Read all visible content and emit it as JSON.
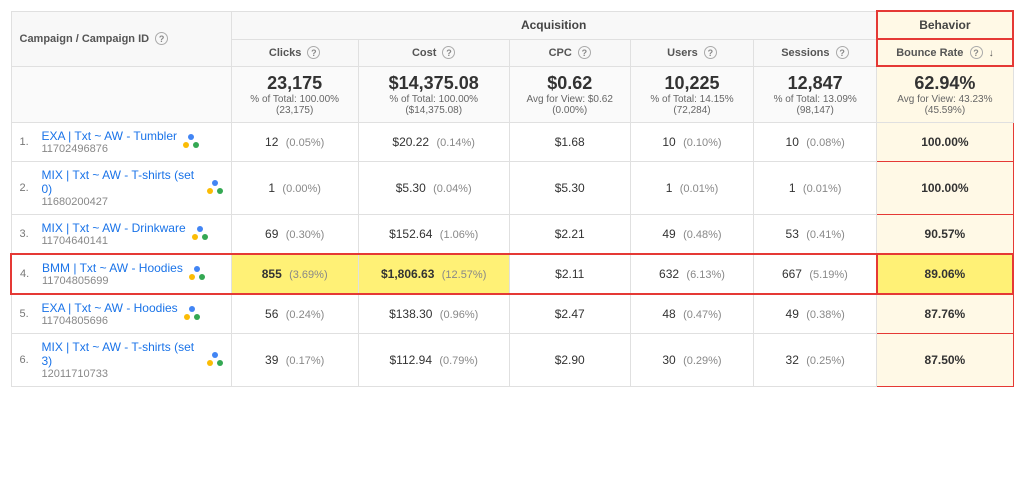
{
  "table": {
    "sections": {
      "acquisition_label": "Acquisition",
      "behavior_label": "Behavior"
    },
    "headers": {
      "campaign": "Campaign / Campaign ID",
      "clicks": "Clicks",
      "cost": "Cost",
      "cpc": "CPC",
      "users": "Users",
      "sessions": "Sessions",
      "bounce_rate": "Bounce Rate"
    },
    "totals": {
      "clicks_main": "23,175",
      "clicks_sub": "% of Total: 100.00% (23,175)",
      "cost_main": "$14,375.08",
      "cost_sub": "% of Total: 100.00% ($14,375.08)",
      "cpc_main": "$0.62",
      "cpc_sub": "Avg for View: $0.62 (0.00%)",
      "users_main": "10,225",
      "users_sub": "% of Total: 14.15% (72,284)",
      "sessions_main": "12,847",
      "sessions_sub": "% of Total: 13.09% (98,147)",
      "bounce_main": "62.94%",
      "bounce_sub": "Avg for View: 43.23% (45.59%)"
    },
    "rows": [
      {
        "rank": "1.",
        "name": "EXA | Txt ~ AW - Tumbler",
        "id": "11702496876",
        "clicks": "12",
        "clicks_pct": "(0.05%)",
        "cost": "$20.22",
        "cost_pct": "(0.14%)",
        "cpc": "$1.68",
        "users": "10",
        "users_pct": "(0.10%)",
        "sessions": "10",
        "sessions_pct": "(0.08%)",
        "bounce": "100.00%",
        "highlight": false
      },
      {
        "rank": "2.",
        "name": "MIX | Txt ~ AW - T-shirts (set 0)",
        "id": "11680200427",
        "clicks": "1",
        "clicks_pct": "(0.00%)",
        "cost": "$5.30",
        "cost_pct": "(0.04%)",
        "cpc": "$5.30",
        "users": "1",
        "users_pct": "(0.01%)",
        "sessions": "1",
        "sessions_pct": "(0.01%)",
        "bounce": "100.00%",
        "highlight": false
      },
      {
        "rank": "3.",
        "name": "MIX | Txt ~ AW - Drinkware",
        "id": "11704640141",
        "clicks": "69",
        "clicks_pct": "(0.30%)",
        "cost": "$152.64",
        "cost_pct": "(1.06%)",
        "cpc": "$2.21",
        "users": "49",
        "users_pct": "(0.48%)",
        "sessions": "53",
        "sessions_pct": "(0.41%)",
        "bounce": "90.57%",
        "highlight": false
      },
      {
        "rank": "4.",
        "name": "BMM | Txt ~ AW - Hoodies",
        "id": "11704805699",
        "clicks": "855",
        "clicks_pct": "(3.69%)",
        "cost": "$1,806.63",
        "cost_pct": "(12.57%)",
        "cpc": "$2.11",
        "users": "632",
        "users_pct": "(6.13%)",
        "sessions": "667",
        "sessions_pct": "(5.19%)",
        "bounce": "89.06%",
        "highlight": true
      },
      {
        "rank": "5.",
        "name": "EXA | Txt ~ AW - Hoodies",
        "id": "11704805696",
        "clicks": "56",
        "clicks_pct": "(0.24%)",
        "cost": "$138.30",
        "cost_pct": "(0.96%)",
        "cpc": "$2.47",
        "users": "48",
        "users_pct": "(0.47%)",
        "sessions": "49",
        "sessions_pct": "(0.38%)",
        "bounce": "87.76%",
        "highlight": false
      },
      {
        "rank": "6.",
        "name": "MIX | Txt ~ AW - T-shirts (set 3)",
        "id": "12011710733",
        "clicks": "39",
        "clicks_pct": "(0.17%)",
        "cost": "$112.94",
        "cost_pct": "(0.79%)",
        "cpc": "$2.90",
        "users": "30",
        "users_pct": "(0.29%)",
        "sessions": "32",
        "sessions_pct": "(0.25%)",
        "bounce": "87.50%",
        "highlight": false
      }
    ]
  }
}
